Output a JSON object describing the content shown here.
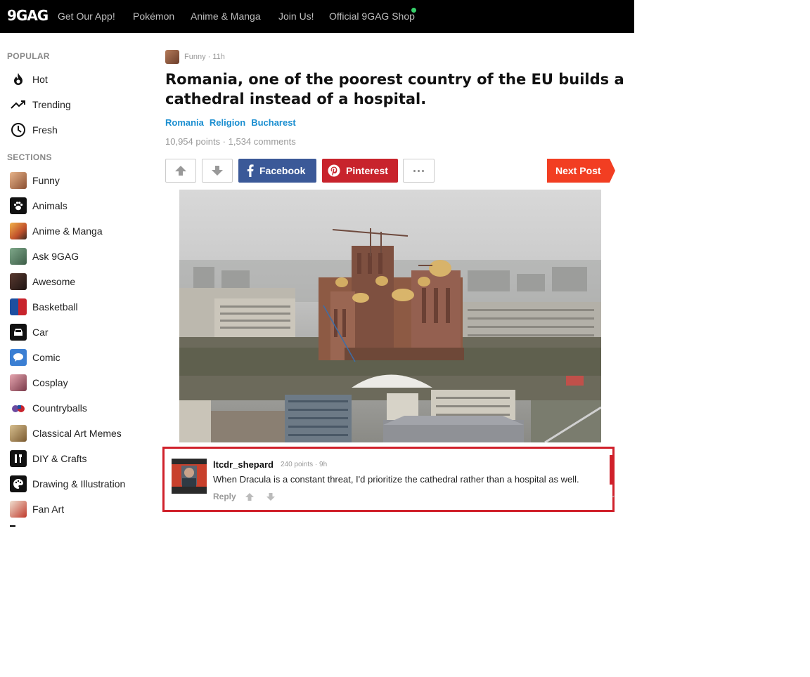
{
  "nav": {
    "logo": "9GAG",
    "items": [
      "Get Our App!",
      "Pokémon",
      "Anime & Manga",
      "Join Us!",
      "Official 9GAG Shop"
    ]
  },
  "sidebar": {
    "popular_heading": "POPULAR",
    "popular": [
      {
        "label": "Hot",
        "icon": "flame-icon"
      },
      {
        "label": "Trending",
        "icon": "trending-icon"
      },
      {
        "label": "Fresh",
        "icon": "clock-icon"
      }
    ],
    "sections_heading": "SECTIONS",
    "sections": [
      {
        "label": "Funny",
        "color": "#c98b5e"
      },
      {
        "label": "Animals",
        "color": "#111111"
      },
      {
        "label": "Anime & Manga",
        "color": "#e0903a"
      },
      {
        "label": "Ask 9GAG",
        "color": "#5c8a6a"
      },
      {
        "label": "Awesome",
        "color": "#3c2a25"
      },
      {
        "label": "Basketball",
        "color": "#1d4fa0"
      },
      {
        "label": "Car",
        "color": "#111111"
      },
      {
        "label": "Comic",
        "color": "#3b7fd3"
      },
      {
        "label": "Cosplay",
        "color": "#b86a7a"
      },
      {
        "label": "Countryballs",
        "color": "#6b4aa0"
      },
      {
        "label": "Classical Art Memes",
        "color": "#b89a6a"
      },
      {
        "label": "DIY & Crafts",
        "color": "#111111"
      },
      {
        "label": "Drawing & Illustration",
        "color": "#111111"
      },
      {
        "label": "Fan Art",
        "color": "#c0392b"
      }
    ]
  },
  "post": {
    "section": "Funny",
    "age": "11h",
    "meta": "Funny · 11h",
    "title": "Romania, one of the poorest country of the EU builds a cathedral instead of a hospital.",
    "tags": [
      "Romania",
      "Religion",
      "Bucharest"
    ],
    "stats": "10,954 points · 1,534 comments"
  },
  "actions": {
    "facebook": "Facebook",
    "pinterest": "Pinterest",
    "next": "Next Post"
  },
  "comment": {
    "username": "ltcdr_shepard",
    "meta": "240 points · 9h",
    "text": "When Dracula is a constant threat, I'd prioritize the cathedral rather than a hospital as well.",
    "reply": "Reply"
  },
  "colors": {
    "facebook": "#3b5998",
    "pinterest": "#c8232c",
    "next": "#f23e22",
    "tag": "#1a8ed0",
    "highlight": "#d0212b"
  }
}
